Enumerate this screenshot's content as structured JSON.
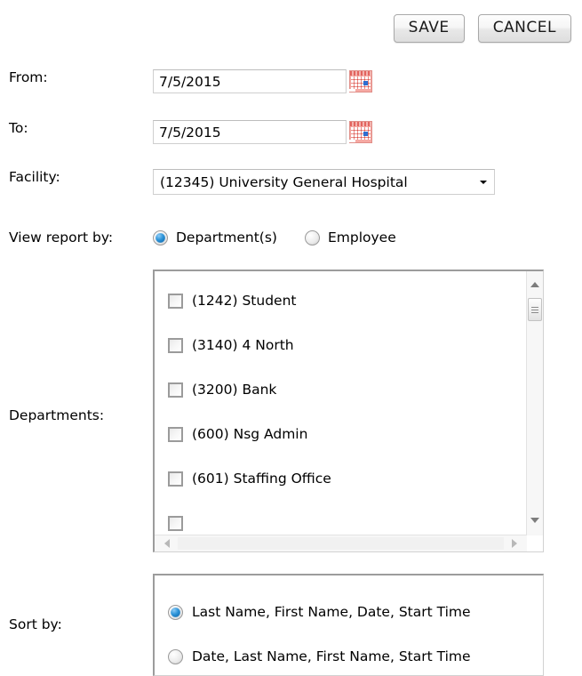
{
  "toolbar": {
    "save_label": "SAVE",
    "cancel_label": "CANCEL"
  },
  "form": {
    "from": {
      "label": "From:",
      "value": "7/5/2015",
      "calendar_icon": "calendar-icon"
    },
    "to": {
      "label": "To:",
      "value": "7/5/2015",
      "calendar_icon": "calendar-icon"
    },
    "facility": {
      "label": "Facility:",
      "selected": "(12345) University General Hospital",
      "arrow_icon": "chevron-down-icon"
    },
    "view_report_by": {
      "label": "View report by:",
      "options": [
        {
          "label": "Department(s)",
          "selected": true
        },
        {
          "label": "Employee",
          "selected": false
        }
      ]
    },
    "departments": {
      "label": "Departments:",
      "items": [
        {
          "label": "(1242) Student",
          "checked": false
        },
        {
          "label": "(3140) 4 North",
          "checked": false
        },
        {
          "label": "(3200) Bank",
          "checked": false
        },
        {
          "label": "(600) Nsg Admin",
          "checked": false
        },
        {
          "label": "(601) Staffing Office",
          "checked": false
        },
        {
          "label": "",
          "checked": false
        }
      ],
      "vertical_scrollbar": {
        "up_icon": "scroll-up-arrow-icon",
        "down_icon": "scroll-down-arrow-icon",
        "thumb": "scroll-thumb"
      },
      "horizontal_scrollbar": {
        "left_icon": "scroll-left-arrow-icon",
        "right_icon": "scroll-right-arrow-icon"
      }
    },
    "sort_by": {
      "label": "Sort by:",
      "options": [
        {
          "label": "Last Name, First Name, Date, Start Time",
          "selected": true
        },
        {
          "label": "Date, Last Name, First Name, Start Time",
          "selected": false
        }
      ]
    }
  },
  "colors": {
    "accent": "#2b93d8",
    "calendar": "#e2645e",
    "border": "#9c9c9c",
    "background": "#ffffff"
  }
}
